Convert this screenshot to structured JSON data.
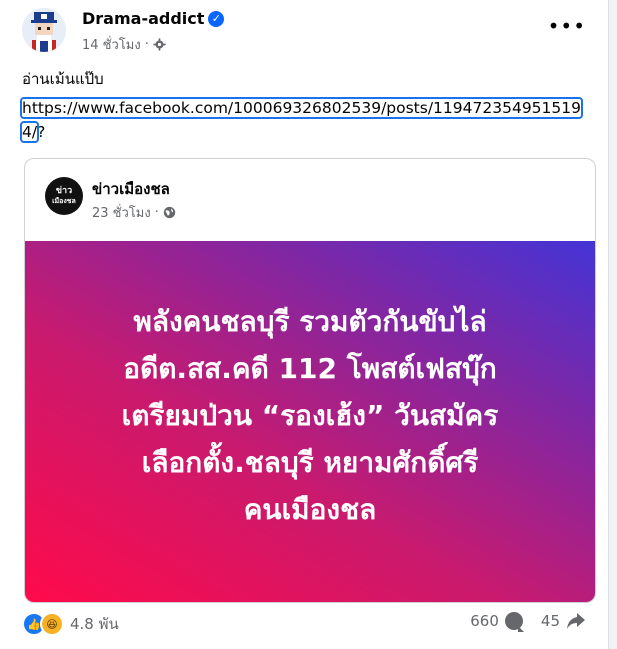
{
  "post": {
    "author": "Drama-addict",
    "time": "14 ชั่วโมง",
    "separator": "·",
    "text": "อ่านเม้นแป๊บ",
    "link": "https://www.facebook.com/100069326802539/posts/1194723549515194/",
    "link_suffix": "?"
  },
  "shared": {
    "avatar_text_top": "ข่าว",
    "avatar_text_bottom": "เมืองชล",
    "page_name": "ข่าวเมืองชล",
    "time": "23 ชั่วโมง",
    "separator": "·",
    "banner_text": "พลังคนชลบุรี รวมตัวกันขับไล่\nอดีต.สส.คดี 112 โพสต์เฟสบุ๊ก\nเตรียมป่วน “รองเฮ้ง” วันสมัคร\nเลือกตั้ง.ชลบุรี หยามศักดิ์ศรี\nคนเมืองชล"
  },
  "footer": {
    "reaction_count": "4.8 พัน",
    "comments": "660",
    "shares": "45"
  },
  "colors": {
    "accent": "#0866ff",
    "banner_start": "#ff0a4a",
    "banner_end": "#4434d6"
  }
}
